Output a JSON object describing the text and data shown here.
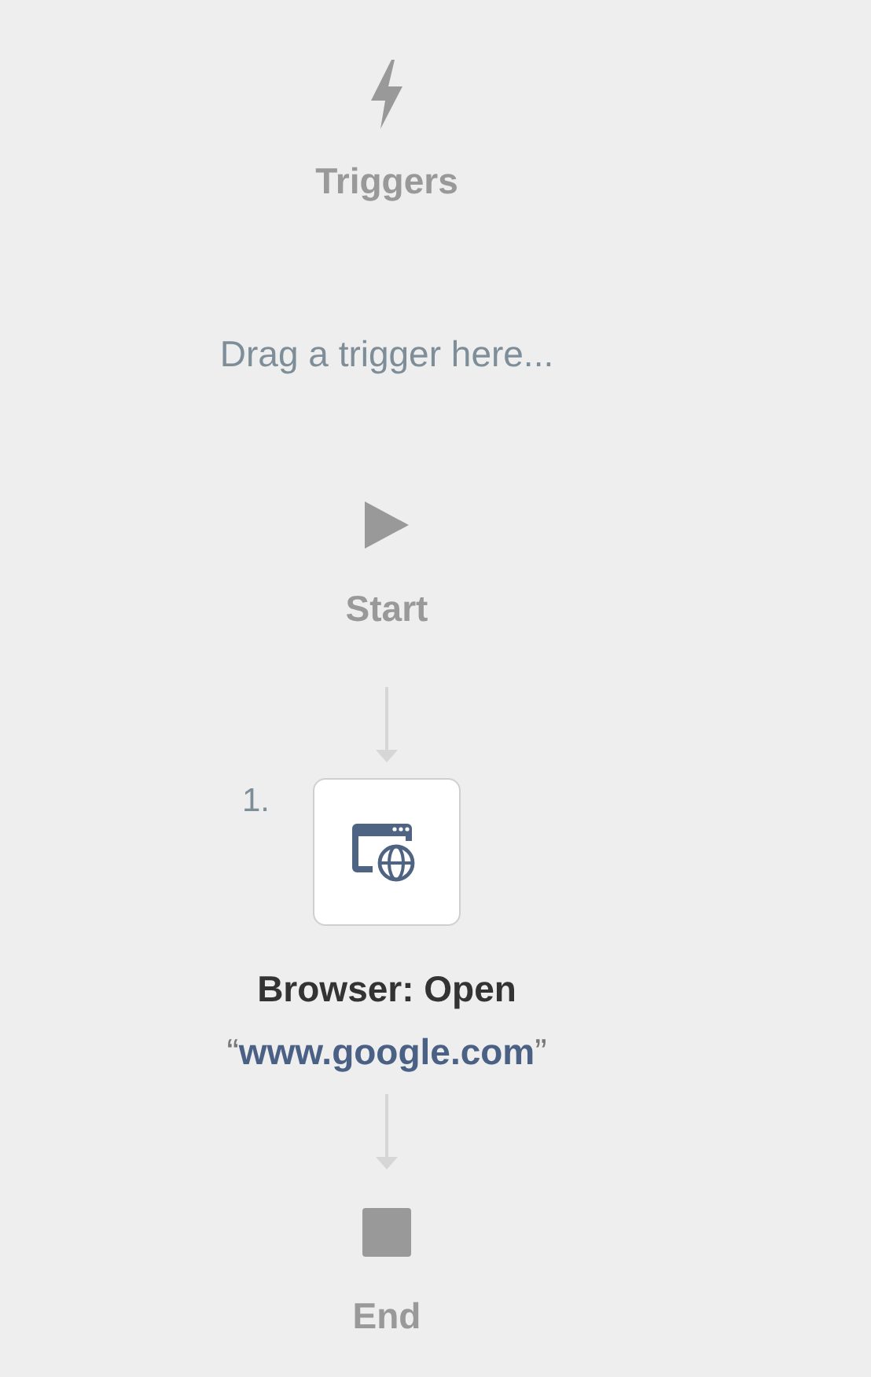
{
  "triggers": {
    "label": "Triggers",
    "placeholder": "Drag a trigger here..."
  },
  "flow": [
    {
      "kind": "start",
      "label": "Start"
    },
    {
      "kind": "action",
      "number": "1.",
      "title": "Browser: Open",
      "argument": {
        "open_quote": "“",
        "value": "www.google.com",
        "close_quote": "”"
      }
    },
    {
      "kind": "end",
      "label": "End"
    }
  ]
}
